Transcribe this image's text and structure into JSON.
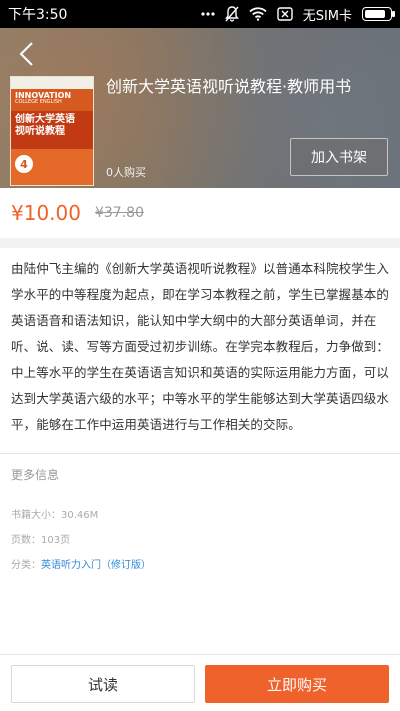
{
  "status_bar": {
    "time": "下午3:50",
    "carrier": "无SIM卡",
    "battery_level": 0.85
  },
  "header": {
    "book_title": "创新大学英语视听说教程·教师用书",
    "buyer_count": "0人购买",
    "add_shelf_label": "加入书架",
    "cover": {
      "top_text": "",
      "brand": "INNOVATION",
      "subtitle_en": "COLLEGE ENGLISH",
      "title_cn": "创新大学英语",
      "title_cn2": "视听说教程",
      "badge_number": "4"
    }
  },
  "price": {
    "current": "¥10.00",
    "original": "¥37.80"
  },
  "description": "由陆仲飞主编的《创新大学英语视听说教程》以普通本科院校学生入学水平的中等程度为起点，即在学习本教程之前，学生已掌握基本的英语语音和语法知识，能认知中学大纲中的大部分英语单词，并在听、说、读、写等方面受过初步训练。在学完本教程后，力争做到：中上等水平的学生在英语语言知识和英语的实际运用能力方面，可以达到大学英语六级的水平；中等水平的学生能够达到大学英语四级水平，能够在工作中运用英语进行与工作相关的交际。",
  "more_info": {
    "title": "更多信息",
    "file_size_label": "书籍大小：30.46M",
    "pages_label": "页数：103页",
    "category_prefix": "分类：",
    "category_link": "英语听力入门（修订版）"
  },
  "bottom_bar": {
    "try_read_label": "试读",
    "buy_now_label": "立即购买"
  },
  "colors": {
    "accent": "#f0622c",
    "link": "#2f89d7"
  }
}
